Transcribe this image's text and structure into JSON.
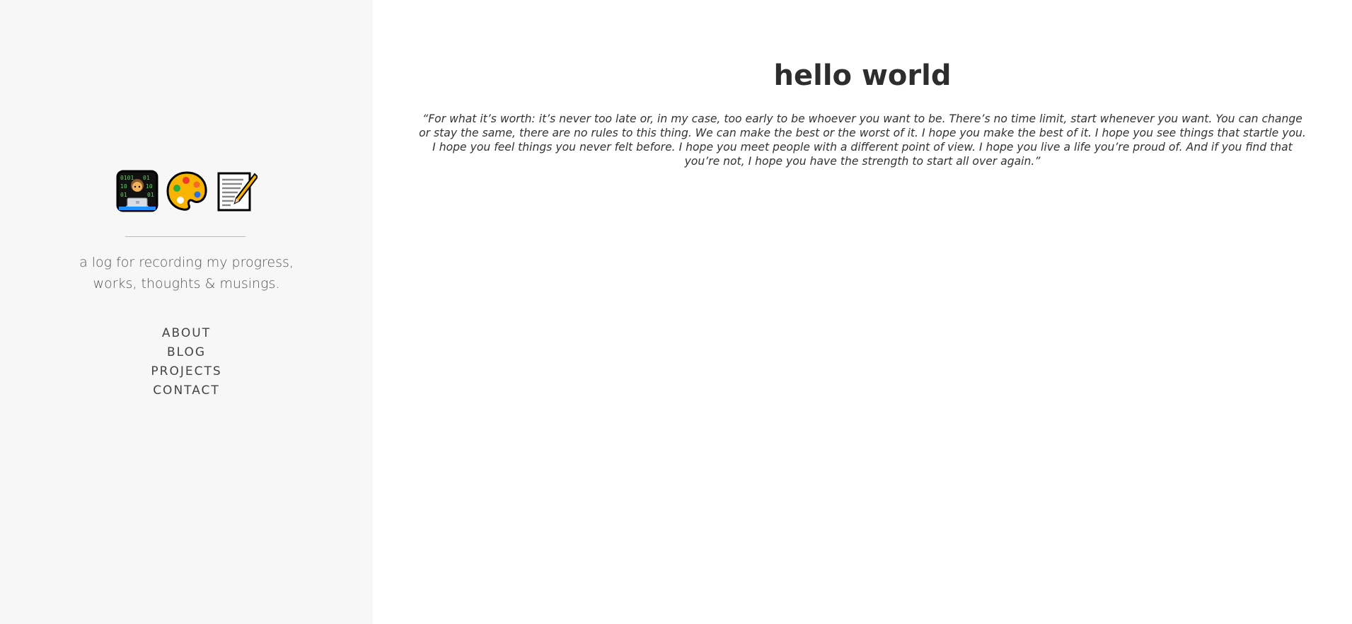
{
  "sidebar": {
    "icons": [
      "technologist-icon",
      "artist-palette-icon",
      "memo-icon"
    ],
    "tagline_line1": "a log for recording my progress,",
    "tagline_line2": "works, thoughts & musings.",
    "nav": [
      {
        "label": "ABOUT"
      },
      {
        "label": "BLOG"
      },
      {
        "label": "PROJECTS"
      },
      {
        "label": "CONTACT"
      }
    ]
  },
  "main": {
    "title": "hello world",
    "quote": "“For what it’s worth: it’s never too late or, in my case, too early to be whoever you want to be. There’s no time limit, start whenever you want. You can change or stay the same, there are no rules to this thing. We can make the best or the worst of it. I hope you make the best of it. I hope you see things that startle you. I hope you feel things you never felt before. I hope you meet people with a different point of view. I hope you live a life you’re proud of. And if you find that you’re not, I hope you have the strength to start all over again.”"
  },
  "colors": {
    "sidebar_bg": "#f7f7f7",
    "main_bg": "#ffffff",
    "text": "#333333"
  }
}
